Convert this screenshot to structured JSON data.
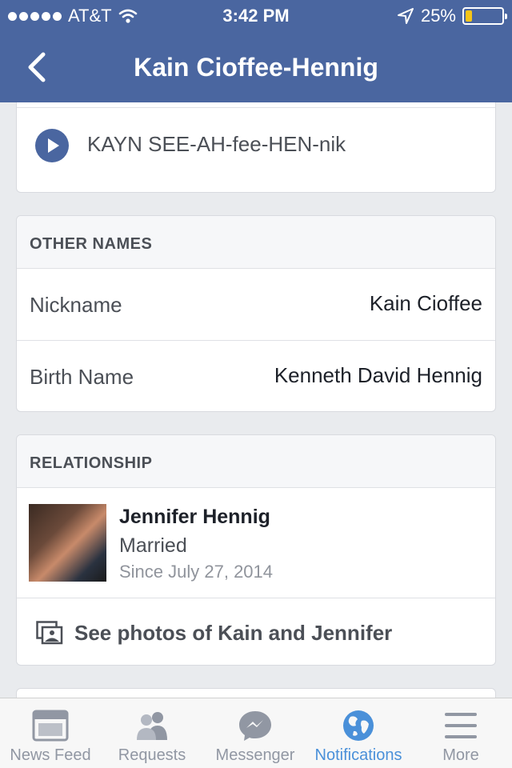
{
  "status_bar": {
    "carrier": "AT&T",
    "time": "3:42 PM",
    "battery": "25%",
    "battery_level": 0.25
  },
  "nav": {
    "title": "Kain Cioffee-Hennig"
  },
  "pronunciation": {
    "text": "KAYN SEE-AH-fee-HEN-nik"
  },
  "other_names": {
    "header": "OTHER NAMES",
    "rows": [
      {
        "label": "Nickname",
        "value": "Kain Cioffee"
      },
      {
        "label": "Birth Name",
        "value": "Kenneth David Hennig"
      }
    ]
  },
  "relationship": {
    "header": "RELATIONSHIP",
    "name": "Jennifer Hennig",
    "status": "Married",
    "since": "Since July 27, 2014",
    "photos_link": "See photos of Kain and Jennifer"
  },
  "tabs": [
    {
      "label": "News Feed",
      "icon": "news-feed-icon",
      "active": false
    },
    {
      "label": "Requests",
      "icon": "friend-requests-icon",
      "active": false
    },
    {
      "label": "Messenger",
      "icon": "messenger-icon",
      "active": false
    },
    {
      "label": "Notifications",
      "icon": "globe-icon",
      "active": true
    },
    {
      "label": "More",
      "icon": "menu-icon",
      "active": false
    }
  ],
  "colors": {
    "brand": "#4a66a0",
    "active_tab": "#4a90d9",
    "battery": "#f5c518"
  }
}
